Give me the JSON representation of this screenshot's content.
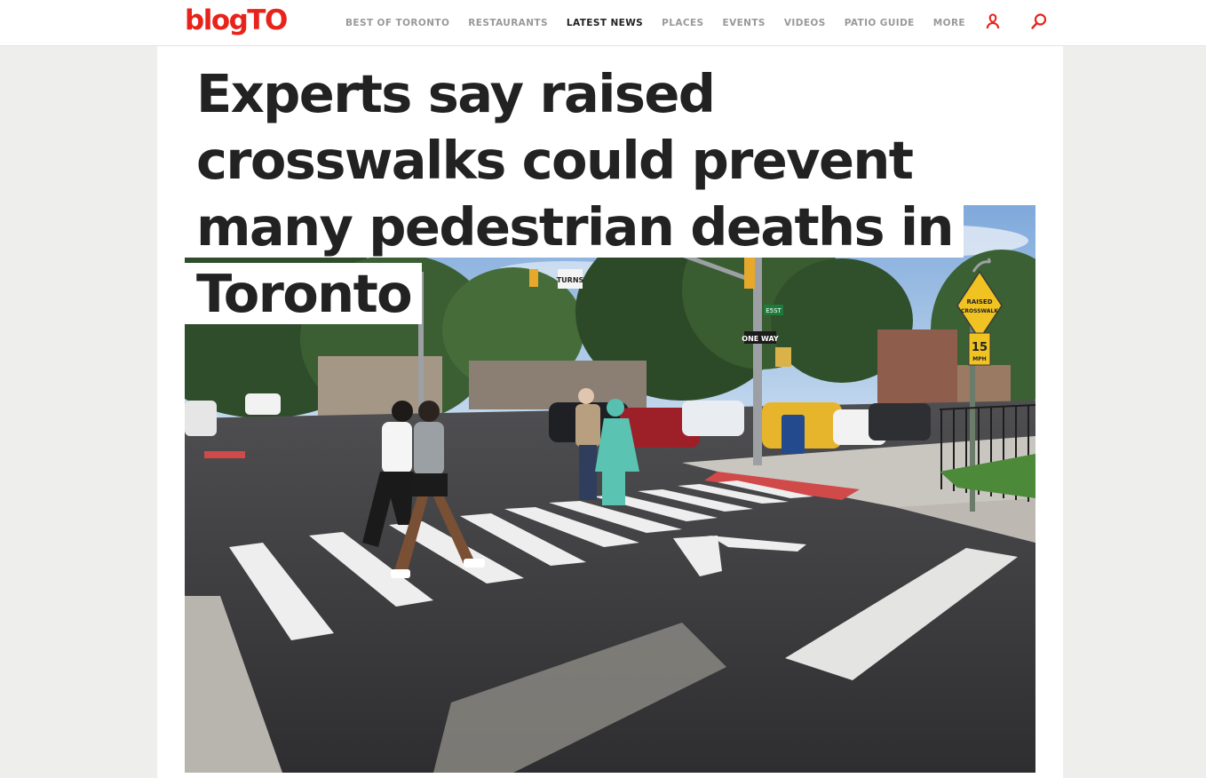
{
  "site": {
    "logo": "blogTO"
  },
  "nav": {
    "items": [
      {
        "label": "BEST OF TORONTO"
      },
      {
        "label": "RESTAURANTS"
      },
      {
        "label": "LATEST NEWS"
      },
      {
        "label": "PLACES"
      },
      {
        "label": "EVENTS"
      },
      {
        "label": "VIDEOS"
      },
      {
        "label": "PATIO GUIDE"
      },
      {
        "label": "MORE"
      }
    ],
    "active_index": 2
  },
  "header_icons": {
    "user": "user-icon",
    "search": "search-icon"
  },
  "article": {
    "title": "Experts say raised crosswalks could prevent many pedestrian deaths in Toronto"
  },
  "photo": {
    "signs": {
      "turns": "TURNS",
      "one_way": "ONE WAY",
      "street": "E5ST",
      "raised_line1": "RAISED",
      "raised_line2": "CROSSWALK",
      "speed": "15",
      "speed_unit": "MPH"
    }
  },
  "colors": {
    "brand": "#e8231b",
    "nav_inactive": "#999999",
    "nav_active": "#222222",
    "headline": "#222222",
    "background": "#eeeeec"
  }
}
